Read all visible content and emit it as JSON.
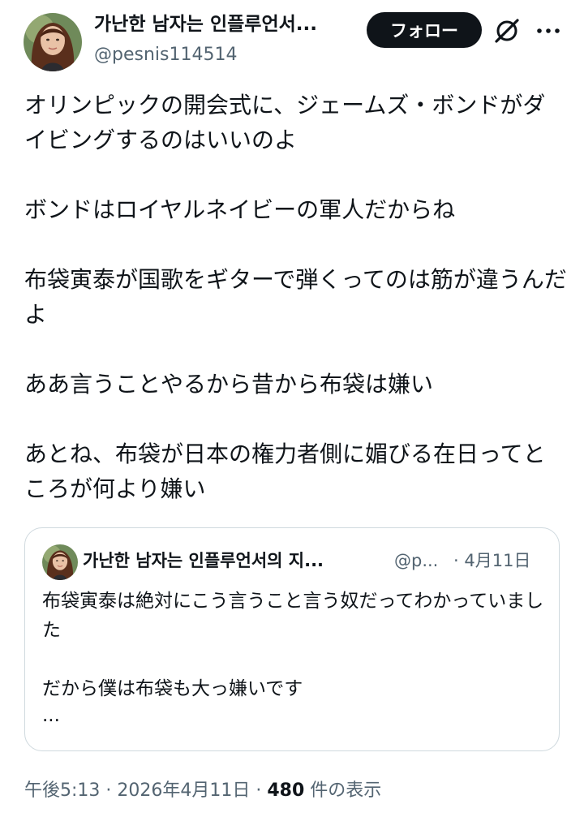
{
  "author": {
    "display_name": "가난한 남자는 인플루언서...",
    "handle": "@pesnis114514"
  },
  "header": {
    "follow_label": "フォロー",
    "grok_icon": "grok-icon",
    "more_icon": "more-icon"
  },
  "tweet": {
    "paragraphs": [
      "オリンピックの開会式に、ジェームズ・ボンドがダイビングするのはいいのよ",
      "ボンドはロイヤルネイビーの軍人だからね",
      "布袋寅泰が国歌をギターで弾くってのは筋が違うんだよ",
      "ああ言うことやるから昔から布袋は嫌い",
      "あとね、布袋が日本の権力者側に媚びる在日ってところが何より嫌い"
    ]
  },
  "quote": {
    "display_name": "가난한 남자는 인플루언서의 지...",
    "handle": "@p...",
    "date": "· 4月11日",
    "paragraphs": [
      "布袋寅泰は絶対にこう言うこと言う奴だってわかっていました",
      "だから僕は布袋も大っ嫌いです"
    ],
    "ellipsis": "..."
  },
  "meta": {
    "time": "午後5:13",
    "separator": " · ",
    "date": "2026年4月11日",
    "separator2": " · ",
    "views_count": "480",
    "views_label": " 件の表示"
  },
  "colors": {
    "text": "#0f1419",
    "secondary": "#536471",
    "border": "#cfd9de",
    "follow_bg": "#0f1419"
  }
}
